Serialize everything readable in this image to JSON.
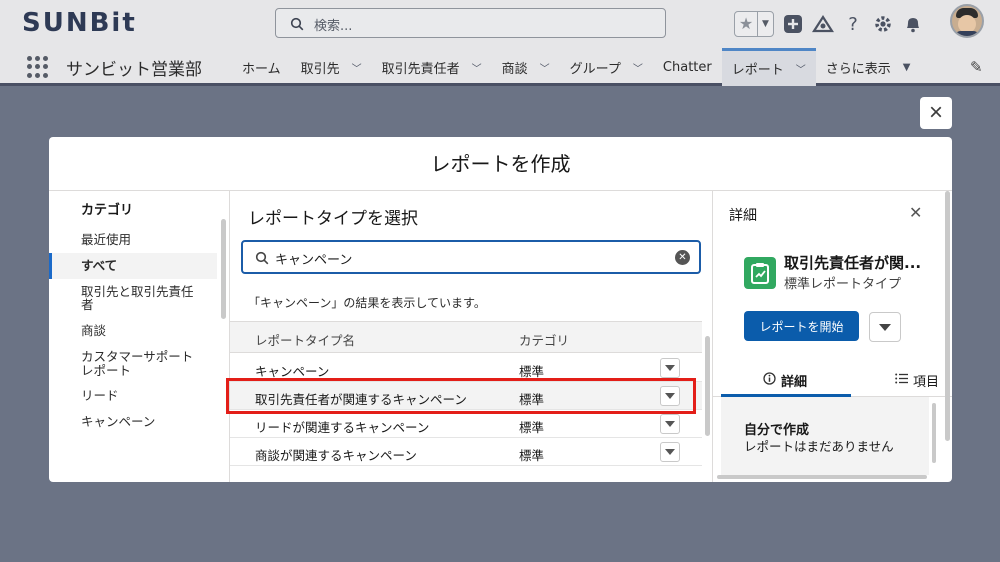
{
  "header": {
    "logo": "SUNBit",
    "search_placeholder": "検索...",
    "avatar": "avatar"
  },
  "nav": {
    "app_name": "サンビット営業部",
    "items": [
      {
        "label": "ホーム",
        "has_menu": false
      },
      {
        "label": "取引先",
        "has_menu": true
      },
      {
        "label": "取引先責任者",
        "has_menu": true
      },
      {
        "label": "商談",
        "has_menu": true
      },
      {
        "label": "グループ",
        "has_menu": true
      },
      {
        "label": "Chatter",
        "has_menu": false
      },
      {
        "label": "レポート",
        "has_menu": true,
        "active": true
      },
      {
        "label": "さらに表示",
        "has_menu": true
      }
    ]
  },
  "modal": {
    "title": "レポートを作成",
    "close_label": "×",
    "categories": {
      "title": "カテゴリ",
      "items": [
        "最近使用",
        "すべて",
        "取引先と取引先責任者",
        "商談",
        "カスタマーサポートレポート",
        "リード",
        "キャンペーン"
      ],
      "active_index": 1
    },
    "report_types": {
      "title": "レポートタイプを選択",
      "search_value": "キャンペーン",
      "result_message": "「キャンペーン」の結果を表示しています。",
      "columns": [
        "レポートタイプ名",
        "カテゴリ"
      ],
      "rows": [
        {
          "name": "キャンペーン",
          "category": "標準"
        },
        {
          "name": "取引先責任者が関連するキャンペーン",
          "category": "標準",
          "highlighted": true
        },
        {
          "name": "リードが関連するキャンペーン",
          "category": "標準"
        },
        {
          "name": "商談が関連するキャンペーン",
          "category": "標準"
        }
      ]
    },
    "details": {
      "title": "詳細",
      "report_name": "取引先責任者が関...",
      "report_subtitle": "標準レポートタイプ",
      "start_button": "レポートを開始",
      "tabs": [
        "詳細",
        "項目"
      ],
      "created_by_me_title": "自分で作成",
      "created_by_me_text": "レポートはまだありません"
    }
  },
  "colors": {
    "accent": "#0b5cab",
    "highlight_border": "#e31e18",
    "icon_green": "#31a860",
    "overlay": "#6b7385"
  }
}
